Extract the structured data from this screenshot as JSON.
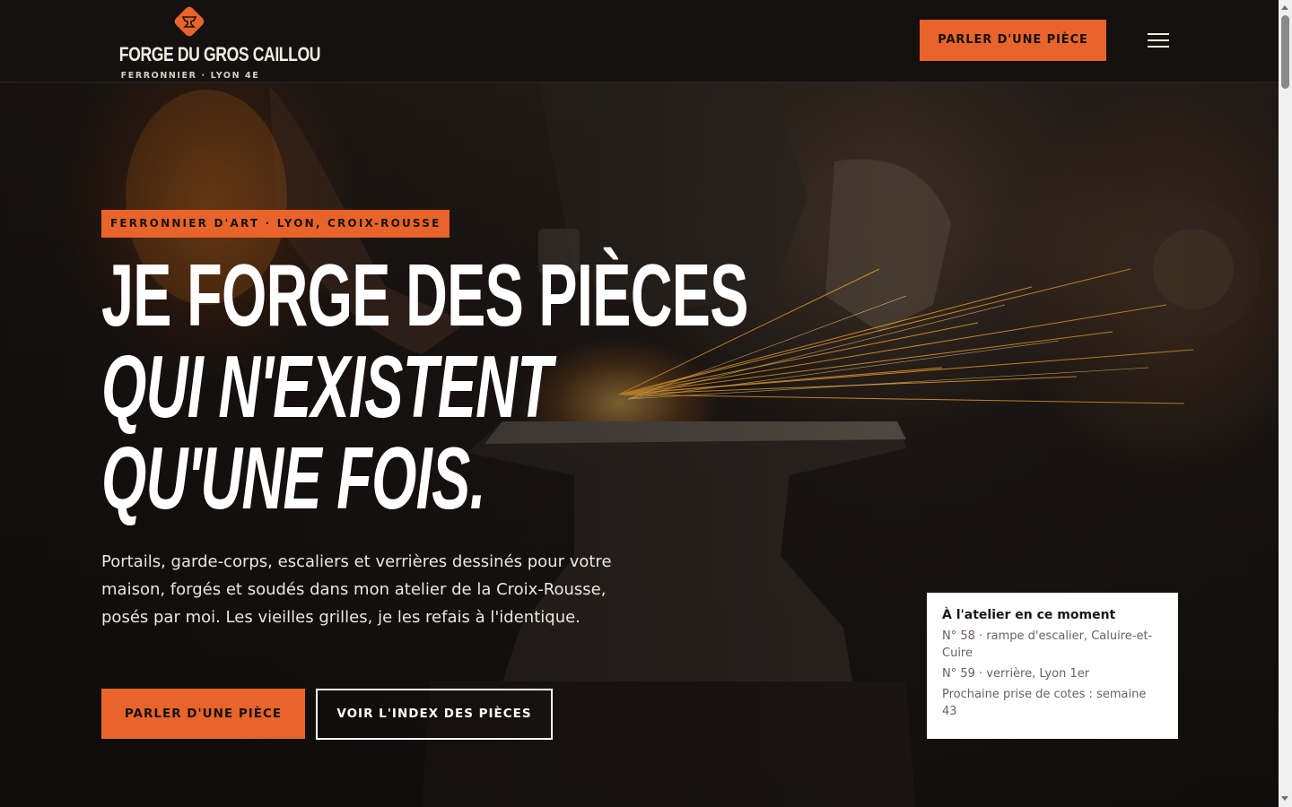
{
  "header": {
    "logo": {
      "name": "FORGE DU GROS CAILLOU",
      "tagline": "FERRONNIER · LYON 4E",
      "icon": "anvil-icon"
    },
    "cta_label": "PARLER D'UNE PIÈCE",
    "menu_icon": "hamburger-menu-icon"
  },
  "hero": {
    "eyebrow": "FERRONNIER D'ART · LYON, CROIX-ROUSSE",
    "headline": {
      "line1": "JE FORGE DES PIÈCES",
      "line2": "QUI N'EXISTENT",
      "line3": "QU'UNE FOIS."
    },
    "lead": "Portails, garde-corps, escaliers et verrières dessinés pour votre maison, forgés et soudés dans mon atelier de la Croix-Rousse, posés par moi. Les vieilles grilles, je les refais à l'identique.",
    "primary_button": "PARLER D'UNE PIÈCE",
    "secondary_button": "VOIR L'INDEX DES PIÈCES"
  },
  "atelier_card": {
    "title": "À l'atelier en ce moment",
    "items": [
      "N° 58 · rampe d'escalier, Caluire-et-Cuire",
      "N° 59 · verrière, Lyon 1er",
      "Prochaine prise de cotes : semaine 43"
    ]
  },
  "colors": {
    "accent": "#e8642a",
    "header_bg": "#141110",
    "text_light": "#ffffff",
    "card_bg": "#ffffff"
  }
}
